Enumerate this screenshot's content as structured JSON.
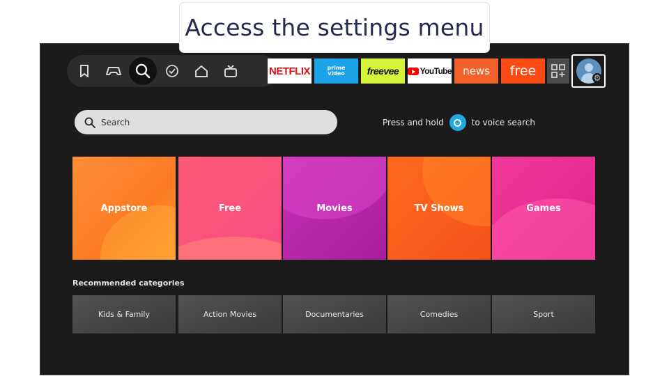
{
  "caption": "Access the settings menu",
  "nav": {
    "icons": [
      "bookmark-icon",
      "game-controller-icon",
      "search-icon",
      "check-circle-icon",
      "home-icon",
      "live-tv-icon"
    ],
    "active": "search-icon"
  },
  "apps": {
    "netflix": "NETFLIX",
    "prime_top": "prime",
    "prime_bottom": "video",
    "freevee": "freevee",
    "youtube": "YouTube",
    "news": "news",
    "free": "free"
  },
  "search": {
    "placeholder": "Search",
    "voice_before": "Press and hold",
    "voice_after": "to voice search"
  },
  "tiles": [
    {
      "label": "Appstore",
      "color": "#fb7b22"
    },
    {
      "label": "Free",
      "color": "#f64d86"
    },
    {
      "label": "Movies",
      "color": "#a81d9d"
    },
    {
      "label": "TV Shows",
      "color": "#f5521a"
    },
    {
      "label": "Games",
      "color": "#e0228d"
    }
  ],
  "recommended": {
    "title": "Recommended categories",
    "items": [
      "Kids & Family",
      "Action Movies",
      "Documentaries",
      "Comedies",
      "Sport"
    ]
  }
}
